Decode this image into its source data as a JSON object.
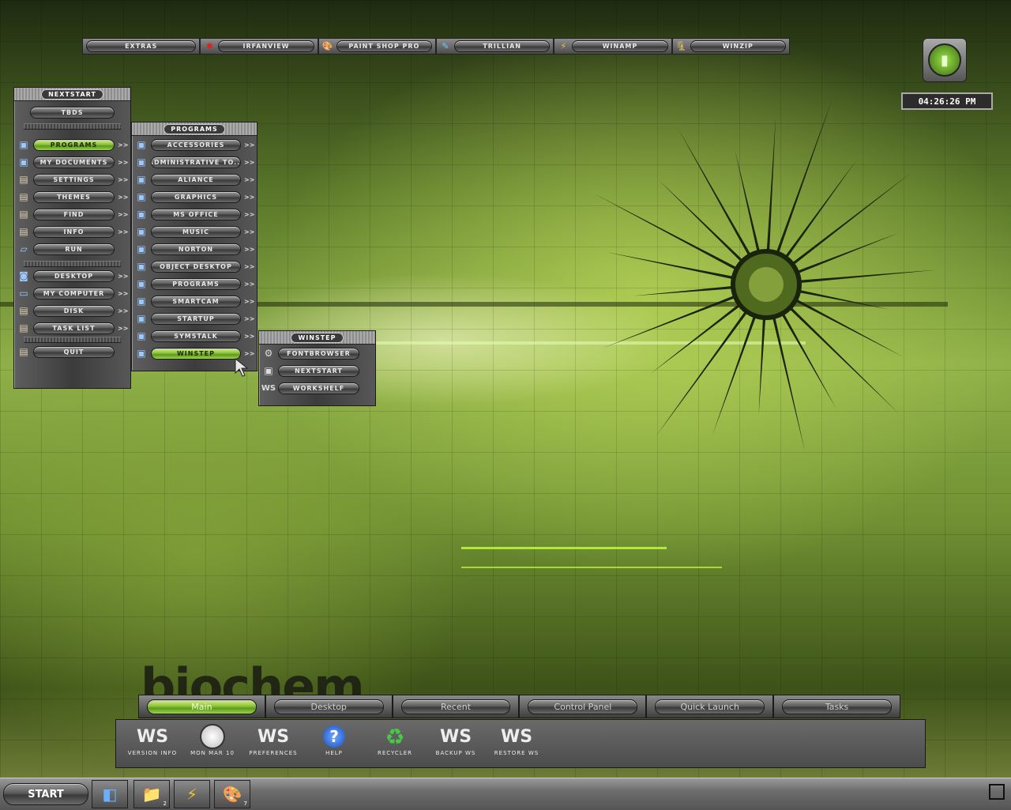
{
  "topbar": {
    "items": [
      {
        "label": "EXTRAS",
        "icon": "none"
      },
      {
        "label": "IRFANVIEW",
        "icon": "irfanview-icon"
      },
      {
        "label": "PAINT SHOP PRO",
        "icon": "paint-palette-icon"
      },
      {
        "label": "TRILLIAN",
        "icon": "trillian-icon"
      },
      {
        "label": "WINAMP",
        "icon": "winamp-icon"
      },
      {
        "label": "WINZIP",
        "icon": "winzip-icon"
      }
    ]
  },
  "clock": {
    "time": "04:26:26 PM"
  },
  "nextstart": {
    "title": "NEXTSTART",
    "top_button": "TBDS",
    "items": [
      {
        "label": "PROGRAMS",
        "active": true
      },
      {
        "label": "MY DOCUMENTS"
      },
      {
        "label": "SETTINGS"
      },
      {
        "label": "THEMES"
      },
      {
        "label": "FIND"
      },
      {
        "label": "INFO"
      },
      {
        "label": "RUN"
      }
    ],
    "items2": [
      {
        "label": "DESKTOP"
      },
      {
        "label": "MY COMPUTER"
      },
      {
        "label": "DISK"
      },
      {
        "label": "TASK LIST"
      }
    ],
    "quit": "QUIT",
    "arrow": ">>"
  },
  "programs": {
    "title": "PROGRAMS",
    "items": [
      {
        "label": "ACCESSORIES"
      },
      {
        "label": "ADMINISTRATIVE TO..."
      },
      {
        "label": "ALIANCE"
      },
      {
        "label": "GRAPHICS"
      },
      {
        "label": "MS OFFICE"
      },
      {
        "label": "MUSIC"
      },
      {
        "label": "NORTON"
      },
      {
        "label": "OBJECT DESKTOP"
      },
      {
        "label": "PROGRAMS"
      },
      {
        "label": "SMARTCAM"
      },
      {
        "label": "STARTUP"
      },
      {
        "label": "SYMSTALK"
      },
      {
        "label": "WINSTEP",
        "active": true
      }
    ]
  },
  "winstep": {
    "title": "WINSTEP",
    "items": [
      {
        "label": "FONTBROWSER"
      },
      {
        "label": "NEXTSTART"
      },
      {
        "label": "WORKSHELF"
      }
    ]
  },
  "wallpaper": {
    "logo_text": "biochem"
  },
  "shelf": {
    "tabs": [
      "Main",
      "Desktop",
      "Recent",
      "Control Panel",
      "Quick Launch",
      "Tasks"
    ],
    "active_tab": "Main",
    "items": [
      {
        "label": "VERSION INFO",
        "icon": "ws-logo-icon"
      },
      {
        "label": "MON MAR 10",
        "icon": "clock-dial-icon"
      },
      {
        "label": "PREFERENCES",
        "icon": "ws-logo-icon"
      },
      {
        "label": "HELP",
        "icon": "help-icon"
      },
      {
        "label": "RECYCLER",
        "icon": "recycle-icon"
      },
      {
        "label": "BACKUP WS",
        "icon": "ws-logo-icon"
      },
      {
        "label": "RESTORE WS",
        "icon": "ws-logo-icon"
      }
    ]
  },
  "taskbar": {
    "start": "START",
    "icons": [
      {
        "name": "desktop-icon",
        "count": ""
      },
      {
        "name": "folder-icon",
        "count": "2"
      },
      {
        "name": "winamp-icon",
        "count": ""
      },
      {
        "name": "paint-palette-icon",
        "count": "7"
      }
    ]
  },
  "colors": {
    "accent_green": "#8cc23a",
    "metal": "#5a5a5a"
  }
}
